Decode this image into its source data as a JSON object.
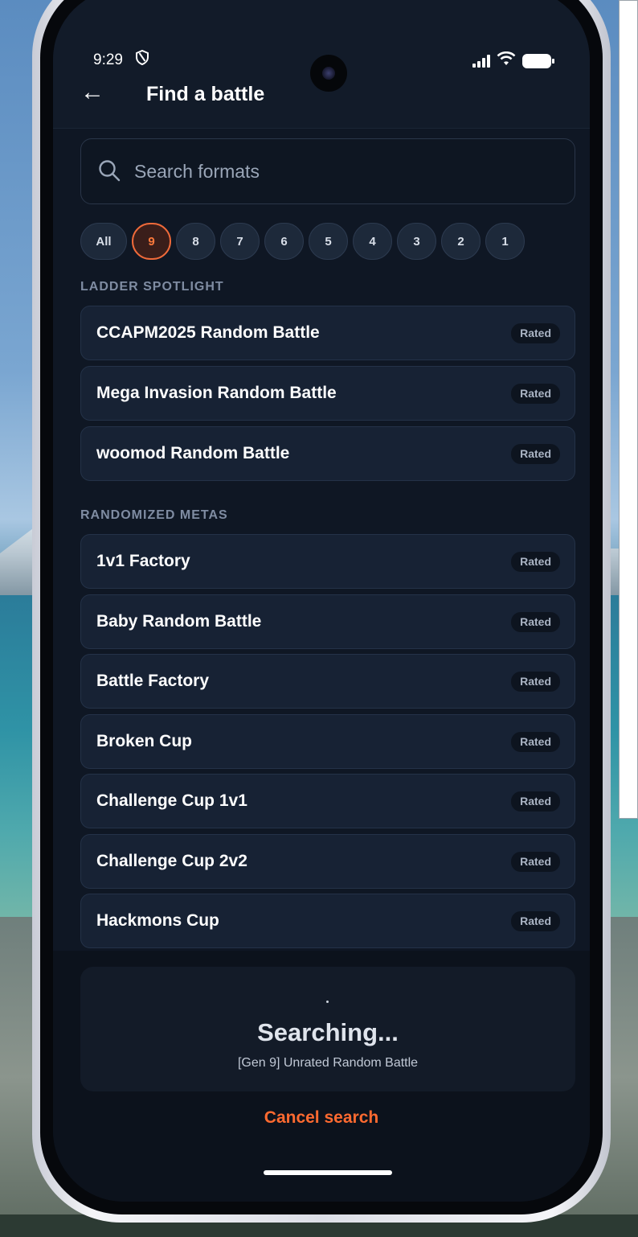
{
  "status_bar": {
    "time": "9:29"
  },
  "header": {
    "back_icon": "arrow-left-icon",
    "title": "Find a battle"
  },
  "search": {
    "placeholder": "Search formats"
  },
  "gen_filters": [
    "All",
    "9",
    "8",
    "7",
    "6",
    "5",
    "4",
    "3",
    "2",
    "1"
  ],
  "active_filter": "9",
  "sections": [
    {
      "title": "LADDER SPOTLIGHT",
      "items": [
        {
          "label": "CCAPM2025 Random Battle",
          "badge": "Rated"
        },
        {
          "label": "Mega Invasion Random Battle",
          "badge": "Rated"
        },
        {
          "label": "woomod Random Battle",
          "badge": "Rated"
        }
      ]
    },
    {
      "title": "RANDOMIZED METAS",
      "items": [
        {
          "label": "1v1 Factory",
          "badge": "Rated"
        },
        {
          "label": "Baby Random Battle",
          "badge": "Rated"
        },
        {
          "label": "Battle Factory",
          "badge": "Rated"
        },
        {
          "label": "Broken Cup",
          "badge": "Rated"
        },
        {
          "label": "Challenge Cup 1v1",
          "badge": "Rated"
        },
        {
          "label": "Challenge Cup 2v2",
          "badge": "Rated"
        },
        {
          "label": "Hackmons Cup",
          "badge": "Rated"
        }
      ]
    }
  ],
  "searching": {
    "status": "Searching...",
    "format": "[Gen 9] Unrated Random Battle",
    "cancel_label": "Cancel search"
  },
  "colors": {
    "accent": "#ff6a30",
    "background": "#0f1724",
    "row": "#172234"
  }
}
